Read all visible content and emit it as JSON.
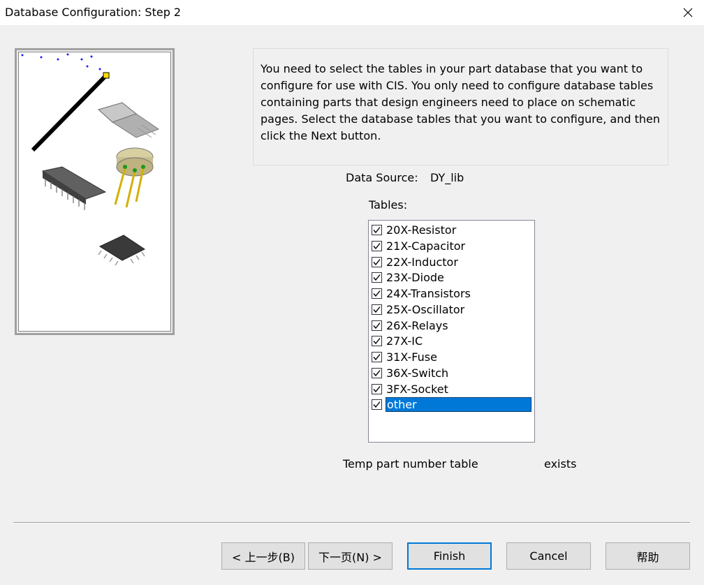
{
  "window": {
    "title": "Database Configuration: Step 2",
    "close_glyph": "✕"
  },
  "info": {
    "text": "You need to select the tables in your part database that you want to configure for use with CIS. You only need to configure database tables containing parts that design engineers need to place on schematic pages. Select the database tables that you want to configure, and then click the Next button."
  },
  "data_source": {
    "label": "Data Source:",
    "value": "DY_lib"
  },
  "tables": {
    "label": "Tables:",
    "items": [
      {
        "label": "20X-Resistor",
        "checked": true
      },
      {
        "label": "21X-Capacitor",
        "checked": true
      },
      {
        "label": "22X-Inductor",
        "checked": true
      },
      {
        "label": "23X-Diode",
        "checked": true
      },
      {
        "label": "24X-Transistors",
        "checked": true
      },
      {
        "label": "25X-Oscillator",
        "checked": true
      },
      {
        "label": "26X-Relays",
        "checked": true
      },
      {
        "label": "27X-IC",
        "checked": true
      },
      {
        "label": "31X-Fuse",
        "checked": true
      },
      {
        "label": "36X-Switch",
        "checked": true
      },
      {
        "label": "3FX-Socket",
        "checked": true
      },
      {
        "label": "other",
        "checked": true,
        "selected": true
      }
    ]
  },
  "temp_table": {
    "label": "Temp part number table",
    "status": "exists"
  },
  "buttons": {
    "back": "< 上一步(B)",
    "next": "下一页(N) >",
    "finish": "Finish",
    "cancel": "Cancel",
    "help": "帮助"
  },
  "colors": {
    "selection": "#0078d7",
    "background": "#f0f0f0",
    "default_button_border": "#0078d7"
  }
}
